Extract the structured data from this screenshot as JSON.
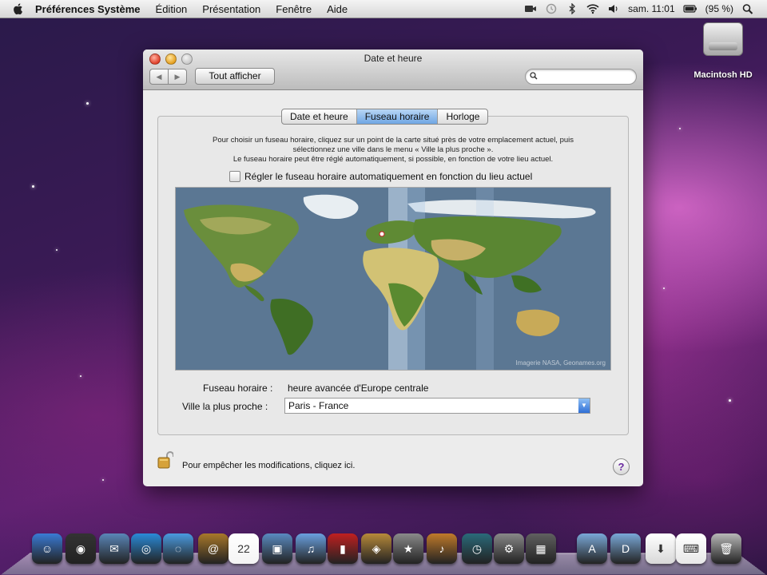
{
  "menubar": {
    "app_name": "Préférences Système",
    "menus": [
      "Édition",
      "Présentation",
      "Fenêtre",
      "Aide"
    ],
    "clock": "sam. 11:01",
    "battery": "(95 %)"
  },
  "desktop": {
    "drive_label": "Macintosh HD"
  },
  "window": {
    "title": "Date et heure",
    "show_all": "Tout afficher",
    "search_placeholder": "",
    "tabs": [
      "Date et heure",
      "Fuseau horaire",
      "Horloge"
    ],
    "active_tab": "Fuseau horaire",
    "help_lines": [
      "Pour choisir un fuseau horaire, cliquez sur un point de la carte situé près de votre emplacement actuel, puis",
      "sélectionnez une ville dans le menu « Ville la plus proche ».",
      "Le fuseau horaire peut être réglé automatiquement, si possible, en fonction de votre lieu actuel."
    ],
    "auto_label": "Régler le fuseau horaire automatiquement en fonction du lieu actuel",
    "auto_checked": false,
    "map_credit": "Imagerie NASA, Geonames.org",
    "timezone_label": "Fuseau horaire :",
    "timezone_value": "heure avancée d'Europe centrale",
    "city_label": "Ville la plus proche :",
    "city_value": "Paris - France",
    "lock_text": "Pour empêcher les modifications, cliquez ici.",
    "help_button": "?"
  },
  "dock": {
    "items": [
      {
        "name": "finder-icon",
        "color": "#3a7bd5",
        "glyph": "☺"
      },
      {
        "name": "dashboard-icon",
        "color": "#333333",
        "glyph": "◉"
      },
      {
        "name": "mail-icon",
        "color": "#5a86b8",
        "glyph": "✉"
      },
      {
        "name": "safari-icon",
        "color": "#2a8ad8",
        "glyph": "◎"
      },
      {
        "name": "ichat-icon",
        "color": "#4a9ae0",
        "glyph": "◌"
      },
      {
        "name": "address-book-icon",
        "color": "#a8782a",
        "glyph": "@"
      },
      {
        "name": "ical-icon",
        "color": "#f4f4f4",
        "glyph": "22"
      },
      {
        "name": "iphoto-icon",
        "color": "#5a8ac0",
        "glyph": "▣"
      },
      {
        "name": "itunes-icon",
        "color": "#6aa0e0",
        "glyph": "♫"
      },
      {
        "name": "photo-booth-icon",
        "color": "#c02020",
        "glyph": "▮"
      },
      {
        "name": "iphoto-library-icon",
        "color": "#b88a3a",
        "glyph": "◈"
      },
      {
        "name": "imovie-icon",
        "color": "#8a8a8a",
        "glyph": "★"
      },
      {
        "name": "garageband-icon",
        "color": "#c07a2a",
        "glyph": "♪"
      },
      {
        "name": "time-machine-icon",
        "color": "#2a6a7a",
        "glyph": "◷"
      },
      {
        "name": "system-preferences-icon",
        "color": "#888888",
        "glyph": "⚙"
      },
      {
        "name": "preview-icon",
        "color": "#606060",
        "glyph": "▦"
      },
      {
        "name": "applications-folder-icon",
        "color": "#7aa8d8",
        "glyph": "A"
      },
      {
        "name": "documents-folder-icon",
        "color": "#7aa8d8",
        "glyph": "D"
      },
      {
        "name": "downloads-stack-icon",
        "color": "#d8d8d8",
        "glyph": "⬇"
      },
      {
        "name": "network-icon",
        "color": "#e8e8e8",
        "glyph": "⌨"
      },
      {
        "name": "trash-icon",
        "color": "#b8b8b8",
        "glyph": "🗑"
      }
    ]
  }
}
